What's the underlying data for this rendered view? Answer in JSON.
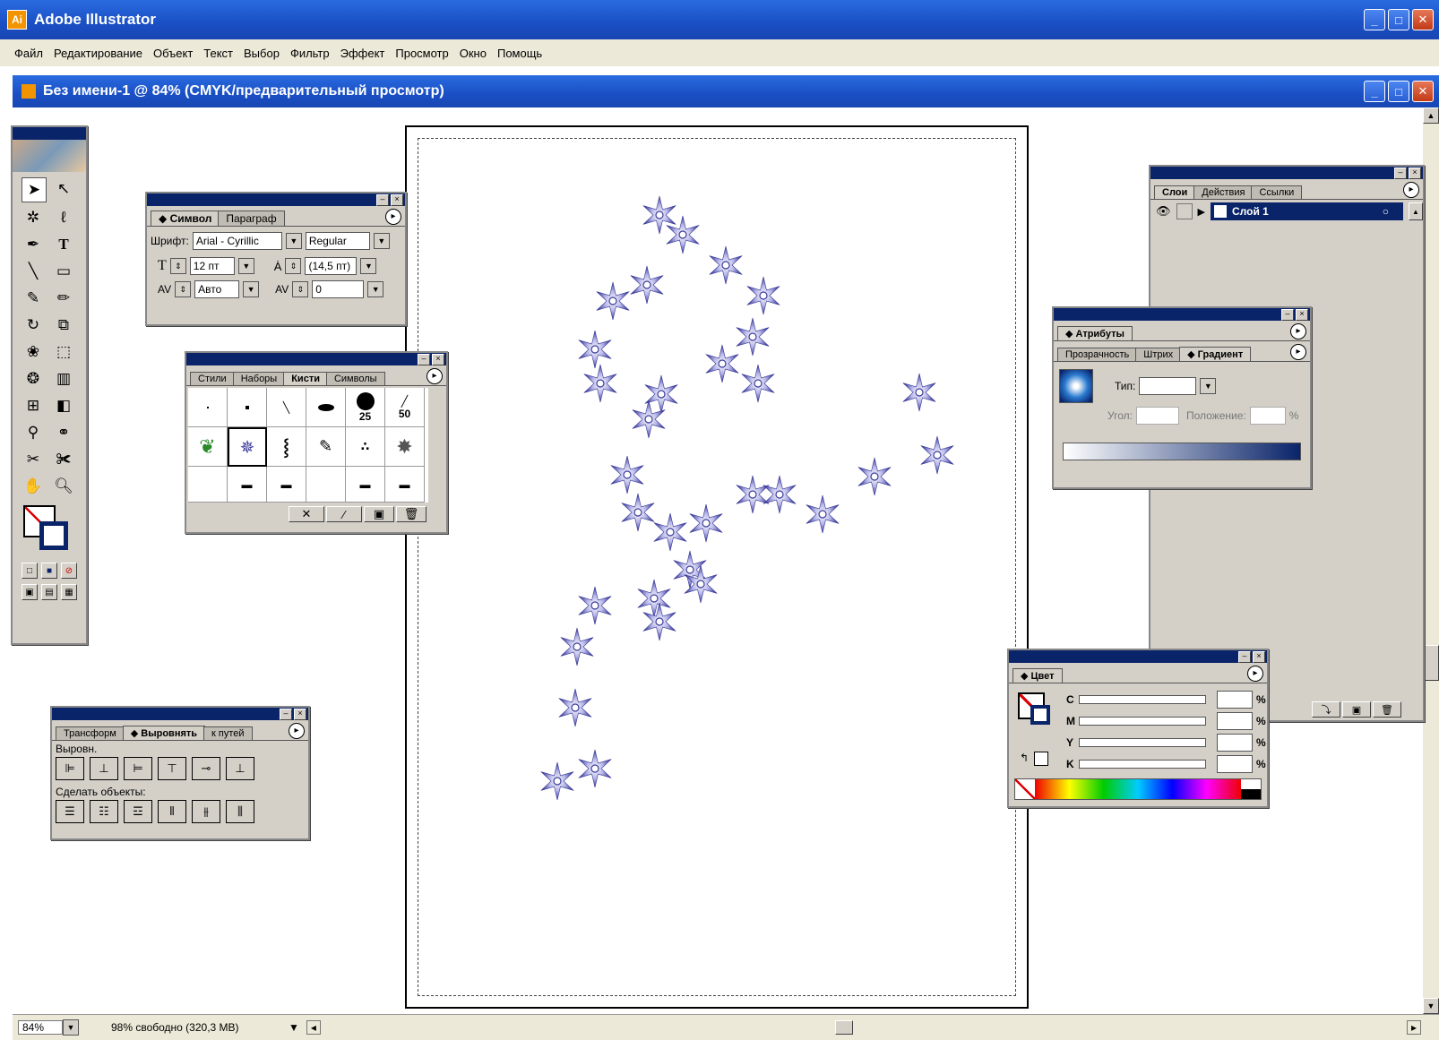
{
  "app": {
    "title": "Adobe Illustrator"
  },
  "menu": [
    "Файл",
    "Редактирование",
    "Объект",
    "Текст",
    "Выбор",
    "Фильтр",
    "Эффект",
    "Просмотр",
    "Окно",
    "Помощь"
  ],
  "document": {
    "title": "Без имени-1 @ 84% (CMYK/предварительный просмотр)"
  },
  "char_panel": {
    "tabs": [
      "Символ",
      "Параграф"
    ],
    "font_label": "Шрифт:",
    "font_value": "Arial - Cyrillic",
    "style_value": "Regular",
    "size_value": "12 пт",
    "leading_value": "(14,5 пт)",
    "tracking_value": "Авто",
    "kerning_value": "0"
  },
  "brush_panel": {
    "tabs": [
      "Стили",
      "Наборы",
      "Кисти",
      "Символы"
    ],
    "sizes": [
      "25",
      "50"
    ]
  },
  "align_panel": {
    "tabs": [
      "Трансформ",
      "Выровнять",
      "к путей"
    ],
    "align_label": "Выровн.",
    "distribute_label": "Сделать объекты:"
  },
  "layers_panel": {
    "tabs": [
      "Слои",
      "Действия",
      "Ссылки"
    ],
    "layer_name": "Слой 1"
  },
  "attr_panel": {
    "tabs": [
      "Атрибуты"
    ],
    "subtabs": [
      "Прозрачность",
      "Штрих",
      "Градиент"
    ],
    "type_label": "Тип:",
    "angle_label": "Угол:",
    "location_label": "Положение:",
    "percent": "%"
  },
  "color_panel": {
    "tab": "Цвет",
    "channels": [
      "C",
      "M",
      "Y",
      "K"
    ],
    "percent": "%"
  },
  "status": {
    "zoom": "84%",
    "info": "98% свободно (320,3 MB)"
  },
  "colors": {
    "star": "#3a3a9a",
    "title_blue": "#1a4fc4",
    "panel_bg": "#d4d0c8"
  }
}
